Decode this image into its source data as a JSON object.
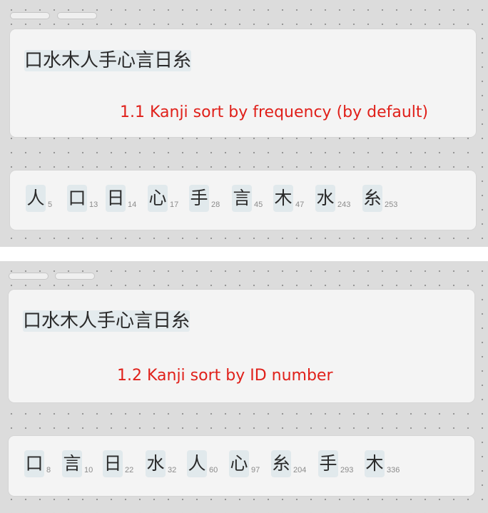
{
  "sections": [
    {
      "input_text": "口水木人手心言日糸",
      "caption": "1.1 Kanji sort by frequency (by default)",
      "tiles": [
        {
          "kanji": "人",
          "num": "5"
        },
        {
          "kanji": "口",
          "num": "13"
        },
        {
          "kanji": "日",
          "num": "14"
        },
        {
          "kanji": "心",
          "num": "17"
        },
        {
          "kanji": "手",
          "num": "28"
        },
        {
          "kanji": "言",
          "num": "45"
        },
        {
          "kanji": "木",
          "num": "47"
        },
        {
          "kanji": "水",
          "num": "243"
        },
        {
          "kanji": "糸",
          "num": "253"
        }
      ]
    },
    {
      "input_text": "口水木人手心言日糸",
      "caption": "1.2 Kanji sort by ID number",
      "tiles": [
        {
          "kanji": "口",
          "num": "8"
        },
        {
          "kanji": "言",
          "num": "10"
        },
        {
          "kanji": "日",
          "num": "22"
        },
        {
          "kanji": "水",
          "num": "32"
        },
        {
          "kanji": "人",
          "num": "60"
        },
        {
          "kanji": "心",
          "num": "97"
        },
        {
          "kanji": "糸",
          "num": "204"
        },
        {
          "kanji": "手",
          "num": "293"
        },
        {
          "kanji": "木",
          "num": "336"
        }
      ]
    }
  ],
  "colors": {
    "caption": "#e0201a",
    "tile_bg": "#e1e9ec",
    "panel_bg": "#dcdcdc",
    "card_bg": "#f4f4f4"
  }
}
